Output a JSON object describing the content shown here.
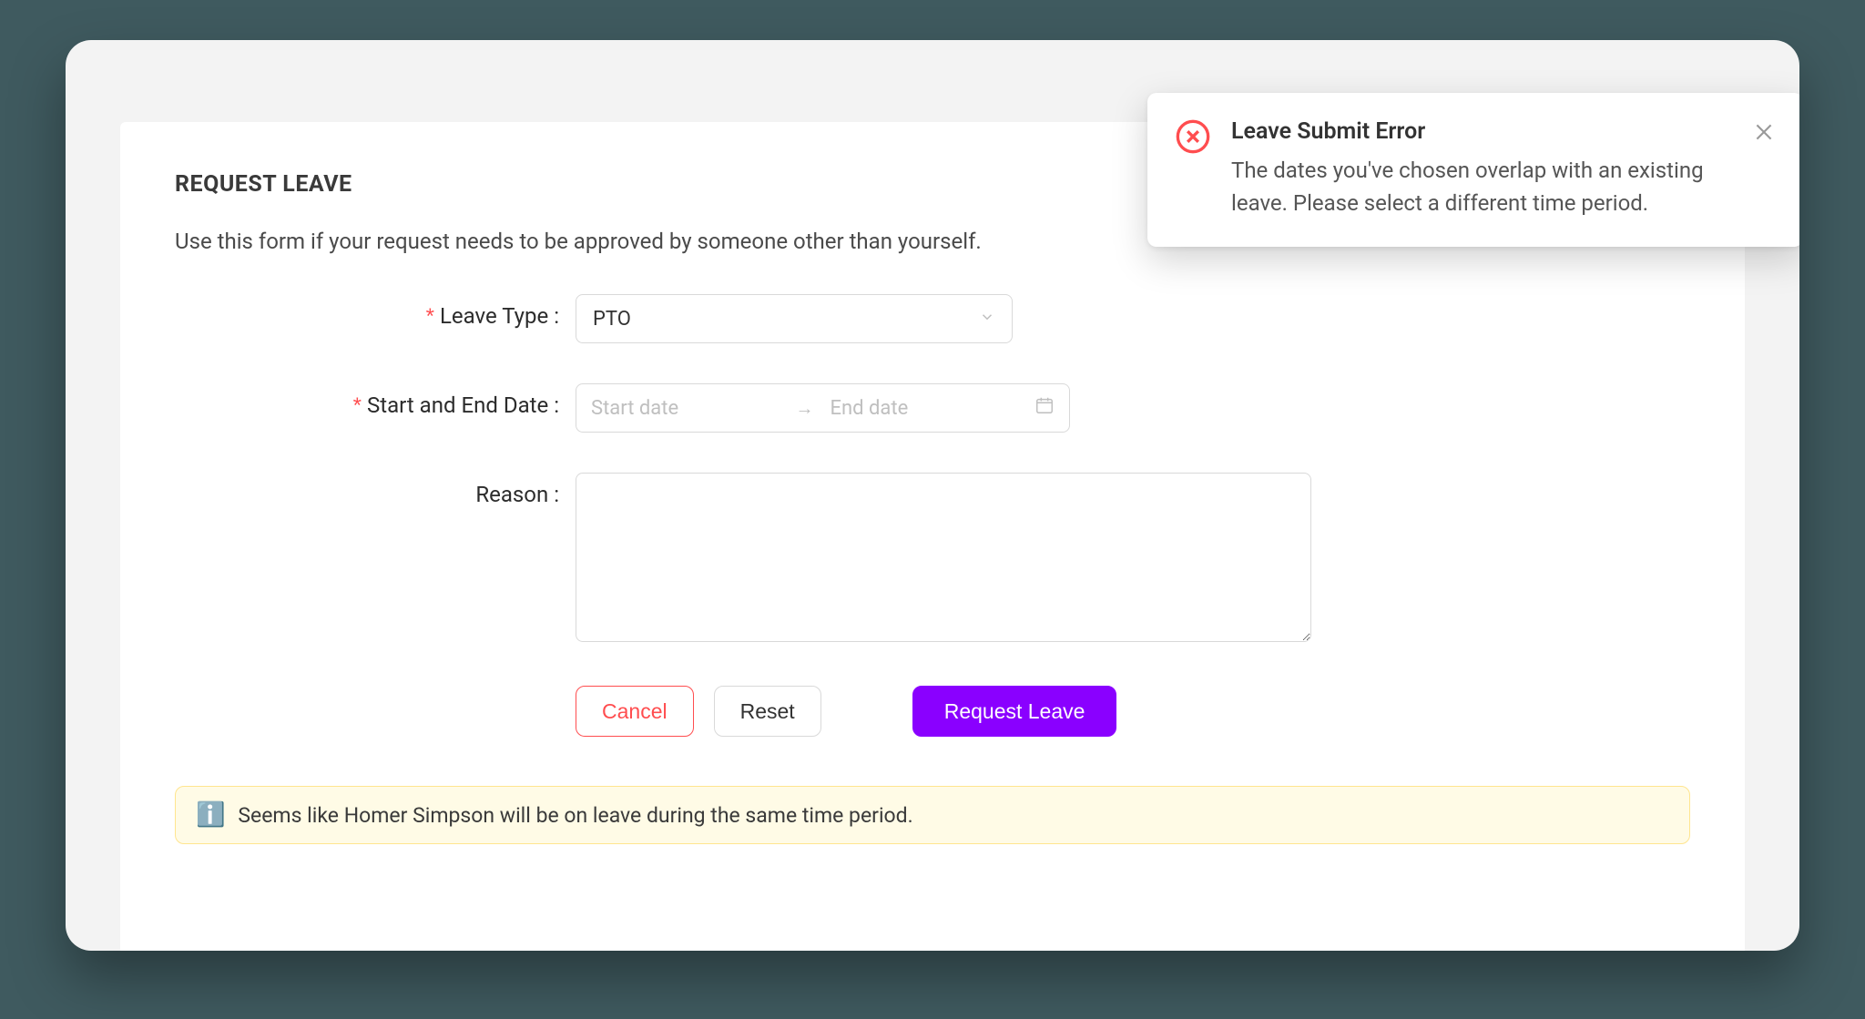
{
  "page": {
    "title": "REQUEST LEAVE",
    "subtext": "Use this form if your request needs to be approved by someone other than yourself."
  },
  "form": {
    "leave_type": {
      "label": "Leave Type",
      "value": "PTO"
    },
    "date_range": {
      "label": "Start and End Date",
      "start_placeholder": "Start date",
      "end_placeholder": "End date"
    },
    "reason": {
      "label": "Reason",
      "value": ""
    },
    "buttons": {
      "cancel": "Cancel",
      "reset": "Reset",
      "submit": "Request Leave"
    }
  },
  "alert": {
    "icon": "ℹ️",
    "text": "Seems like Homer Simpson will be on leave during the same time period."
  },
  "toast": {
    "title": "Leave Submit Error",
    "message": "The dates you've chosen overlap with an existing leave. Please select a different time period."
  }
}
